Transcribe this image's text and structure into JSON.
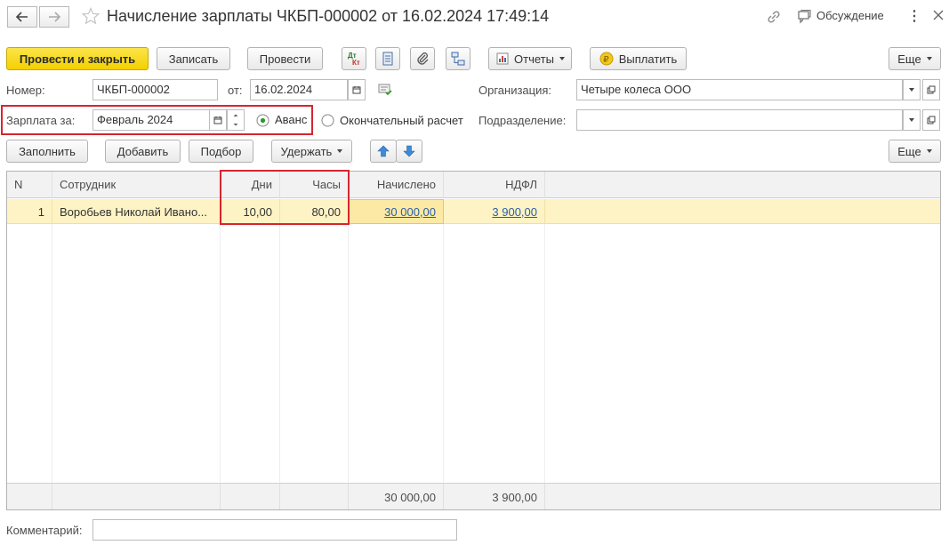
{
  "window": {
    "title": "Начисление зарплаты ЧКБП-000002 от 16.02.2024 17:49:14",
    "discussion_label": "Обсуждение"
  },
  "toolbar": {
    "post_close_label": "Провести и закрыть",
    "save_label": "Записать",
    "post_label": "Провести",
    "dtkt_label": "Дт Кт",
    "reports_label": "Отчеты",
    "pay_label": "Выплатить",
    "more_label": "Еще"
  },
  "form": {
    "number_label": "Номер:",
    "number_value": "ЧКБП-000002",
    "date_label": "от:",
    "date_value": "16.02.2024",
    "org_label": "Организация:",
    "org_value": "Четыре колеса ООО",
    "salary_for_label": "Зарплата за:",
    "salary_for_value": "Февраль 2024",
    "advance_label": "Аванс",
    "final_label": "Окончательный расчет",
    "dept_label": "Подразделение:",
    "dept_value": ""
  },
  "table_toolbar": {
    "fill_label": "Заполнить",
    "add_label": "Добавить",
    "pick_label": "Подбор",
    "withhold_label": "Удержать",
    "more_label": "Еще"
  },
  "table": {
    "columns": [
      "N",
      "Сотрудник",
      "Дни",
      "Часы",
      "Начислено",
      "НДФЛ"
    ],
    "rows": [
      {
        "n": "1",
        "employee": "Воробьев Николай Ивано...",
        "days": "10,00",
        "hours": "80,00",
        "accrued": "30 000,00",
        "ndfl": "3 900,00"
      }
    ],
    "totals": {
      "accrued": "30 000,00",
      "ndfl": "3 900,00"
    }
  },
  "comment": {
    "label": "Комментарий:",
    "value": ""
  },
  "colors": {
    "primary_button": "#f4d000",
    "highlight_row": "#fdf3c4",
    "annotation_red": "#d6262e",
    "link": "#2a5ea8"
  }
}
